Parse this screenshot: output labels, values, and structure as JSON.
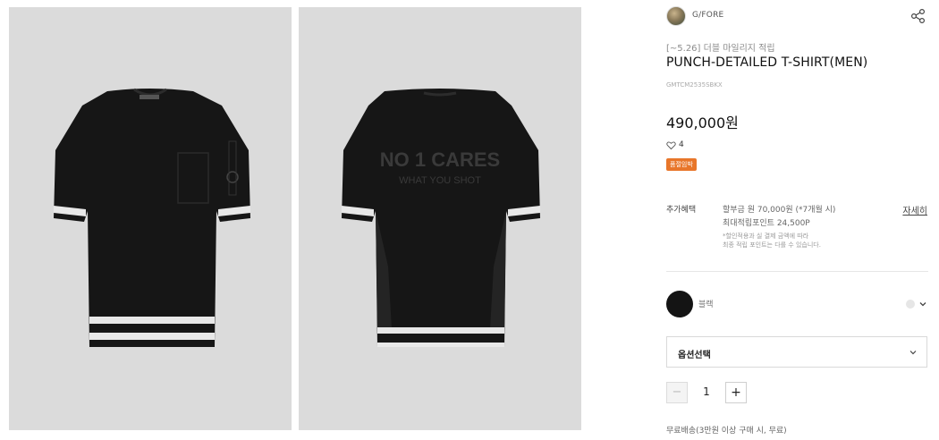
{
  "gallery": {
    "front_image_label": "front view",
    "back_image_label": "back view",
    "back_print_line1": "NO 1 CARES",
    "back_print_line2": "WHAT YOU SHOT"
  },
  "brand": {
    "name": "G/FORE"
  },
  "product": {
    "promo": "[~5.26] 더블 마일리지 적립",
    "title": "PUNCH-DETAILED T-SHIRT(MEN)",
    "sku": "GMTCM2535SBKX",
    "price": "490,000원",
    "likes": "4",
    "badge": "품절임박"
  },
  "benefits": {
    "label": "추가혜택",
    "line1": "할부금 원 70,000원 (*7개월 시)",
    "line2": "최대적립포인트 24,500P",
    "note1": "*할인적용과 실 결제 금액에 따라",
    "note2": "최종 적립 포인트는 다를 수 있습니다.",
    "detail_link": "자세히"
  },
  "color": {
    "name": "블랙",
    "swatch": "#141414"
  },
  "option": {
    "label": "옵션선택"
  },
  "quantity": {
    "minus": "−",
    "value": "1",
    "plus": "+"
  },
  "shipping": {
    "text": "무료배송(3만원 이상 구매 시, 무료)"
  },
  "icons": {
    "share": "share-icon",
    "heart": "heart-icon",
    "chevron": "chevron-down-icon"
  }
}
